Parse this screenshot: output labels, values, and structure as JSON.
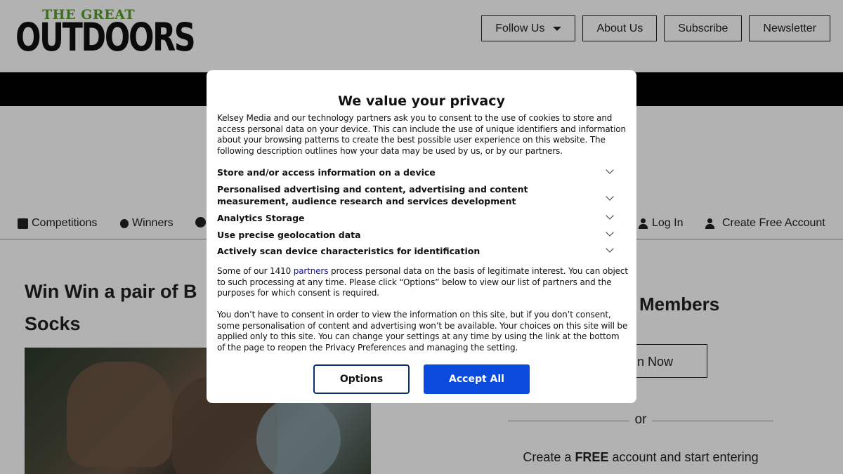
{
  "header": {
    "logo_top": "THE GREAT",
    "logo_main": "OUTDOORS",
    "nav": [
      {
        "label": "Follow Us"
      },
      {
        "label": "About Us"
      },
      {
        "label": "Subscribe"
      },
      {
        "label": "Newsletter"
      }
    ]
  },
  "subnav": {
    "competitions": "Competitions",
    "winners": "Winners",
    "login": "Log In",
    "create_account": "Create Free Account"
  },
  "article": {
    "title": "Win Win a pair of B",
    "title_line2": "Socks"
  },
  "sidebar": {
    "members": "Members",
    "login_partial": "n Now",
    "or": "or",
    "create_prefix": "Create a ",
    "create_bold": "FREE",
    "create_suffix": " account and start entering"
  },
  "consent": {
    "title": "We value your privacy",
    "intro": "Kelsey Media and our technology partners ask you to consent to the use of cookies to store and access personal data on your device. This can include the use of unique identifiers and information about your browsing patterns to create the best possible user experience on this website. The following description outlines how your data may be used by us, or by our partners.",
    "purposes": [
      {
        "label": "Store and/or access information on a device"
      },
      {
        "label": "Personalised advertising and content, advertising and content measurement, audience research and services development"
      },
      {
        "label": "Analytics Storage"
      },
      {
        "label": "Use precise geolocation data"
      },
      {
        "label": "Actively scan device characteristics for identification"
      }
    ],
    "legit_prefix": "Some of our 1410 ",
    "legit_link": "partners",
    "legit_suffix": " process personal data on the basis of legitimate interest. You can object to such processing at any time. Please click “Options” below to view our list of partners and the purposes for which consent is required.",
    "no_consent": "You don’t have to consent in order to view the information on this site, but if you don’t consent, some personalisation of content and advertising won’t be available. Your choices on this site will be applied only to this site. You can change your settings at any time by using the link at the bottom of the page to reopen the Privacy Preferences and managing the setting.",
    "options_label": "Options",
    "accept_label": "Accept All"
  },
  "colors": {
    "accept_button": "#0a4bde",
    "options_border": "#0b2e6e",
    "logo_green": "#5a9e2f",
    "link": "#1a0dab"
  },
  "icons": [
    "chevron-down-icon",
    "gift-icon",
    "award-icon",
    "help-icon",
    "user-icon",
    "user-plus-icon",
    "caret-down-icon"
  ]
}
